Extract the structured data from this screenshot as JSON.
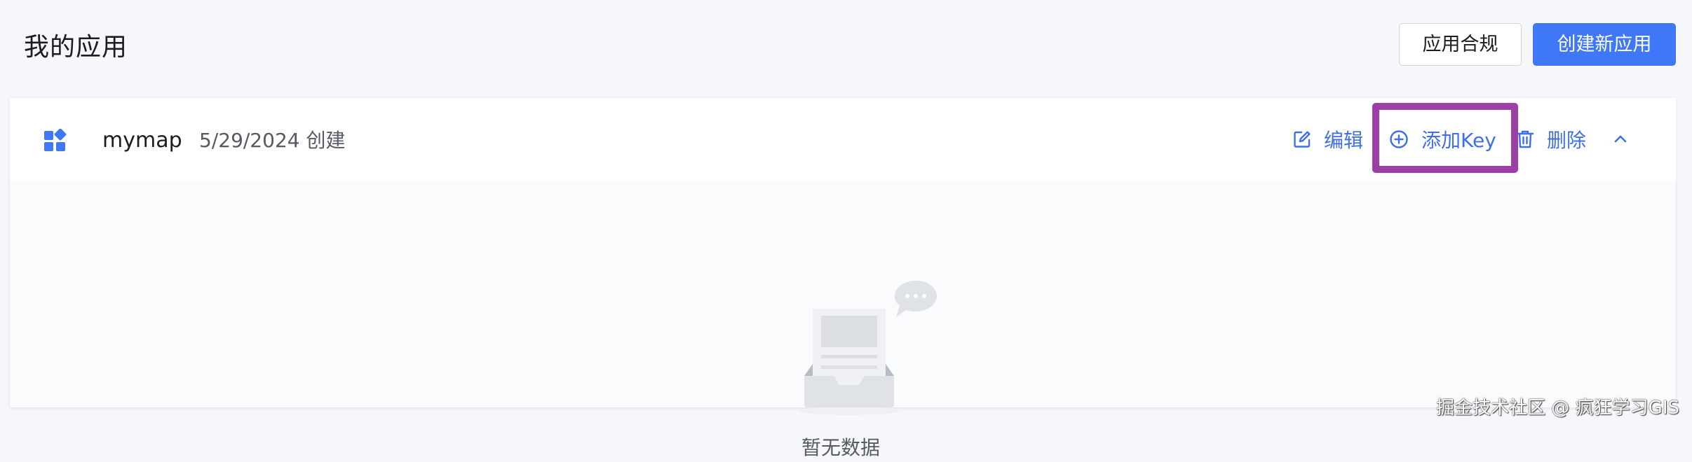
{
  "page": {
    "title": "我的应用"
  },
  "toolbar": {
    "compliance_label": "应用合规",
    "create_label": "创建新应用"
  },
  "app": {
    "name": "mymap",
    "created": "5/29/2024 创建",
    "icon": "apps-grid-icon",
    "actions": {
      "edit": "编辑",
      "add_key": "添加Key",
      "delete": "删除"
    },
    "action_icons": {
      "edit": "edit-icon",
      "add_key": "plus-circle-icon",
      "delete": "trash-icon",
      "collapse": "chevron-up-icon"
    }
  },
  "empty_state": {
    "text": "暂无数据",
    "illustration": "empty-inbox-illustration"
  },
  "watermark": "掘金技术社区 @ 疯狂学习GIS",
  "colors": {
    "primary": "#3e77f7",
    "link": "#3e6fe8",
    "highlight": "#9b3fa6",
    "page_bg": "#f5f7fb"
  }
}
